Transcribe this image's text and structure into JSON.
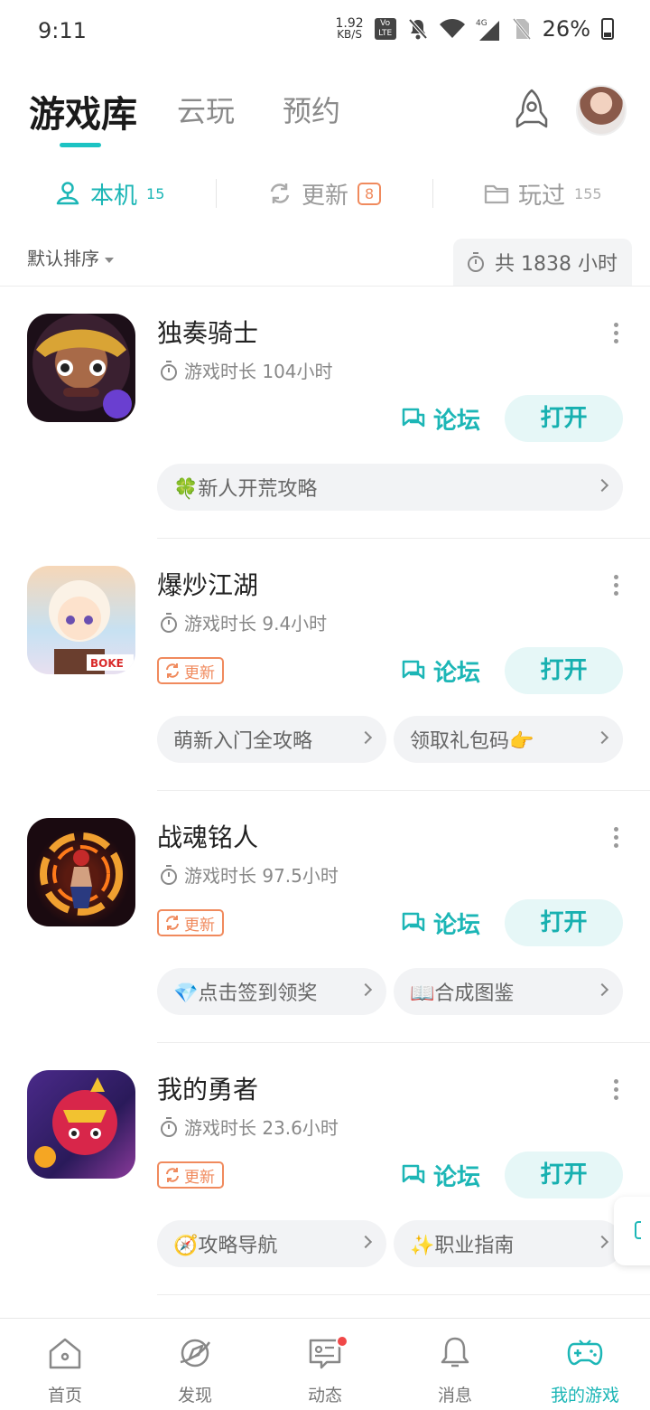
{
  "status_bar": {
    "time": "9:11",
    "net_speed": "1.92",
    "net_unit": "KB/S",
    "volte": "Vo LTE",
    "network": "4G",
    "battery": "26%"
  },
  "header": {
    "tabs": [
      {
        "label": "游戏库",
        "active": true
      },
      {
        "label": "云玩",
        "active": false
      },
      {
        "label": "预约",
        "active": false
      }
    ],
    "rocket_icon": "rocket-icon",
    "avatar_icon": "user-avatar"
  },
  "subtabs": [
    {
      "label": "本机",
      "count": "15",
      "icon": "user-device-icon",
      "active": true
    },
    {
      "label": "更新",
      "badge": "8",
      "icon": "refresh-icon",
      "active": false
    },
    {
      "label": "玩过",
      "count": "155",
      "icon": "folder-icon",
      "active": false
    }
  ],
  "sort": {
    "label": "默认排序",
    "total_hours": "共 1838 小时"
  },
  "games": [
    {
      "name": "独奏骑士",
      "playtime": "游戏时长 104小时",
      "has_update": false,
      "forum_label": "论坛",
      "open_label": "打开",
      "chips": [
        "🍀新人开荒攻略"
      ]
    },
    {
      "name": "爆炒江湖",
      "playtime": "游戏时长 9.4小时",
      "has_update": true,
      "update_label": "更新",
      "forum_label": "论坛",
      "open_label": "打开",
      "chips": [
        "萌新入门全攻略",
        "领取礼包码👉"
      ]
    },
    {
      "name": "战魂铭人",
      "playtime": "游戏时长 97.5小时",
      "has_update": true,
      "update_label": "更新",
      "forum_label": "论坛",
      "open_label": "打开",
      "chips": [
        "💎点击签到领奖",
        "📖合成图鉴"
      ]
    },
    {
      "name": "我的勇者",
      "playtime": "游戏时长 23.6小时",
      "has_update": true,
      "update_label": "更新",
      "forum_label": "论坛",
      "open_label": "打开",
      "chips": [
        "🧭攻略导航",
        "✨职业指南"
      ]
    }
  ],
  "bottom_nav": [
    {
      "label": "首页",
      "icon": "home-icon",
      "active": false
    },
    {
      "label": "发现",
      "icon": "discover-icon",
      "active": false
    },
    {
      "label": "动态",
      "icon": "message-dynamic-icon",
      "active": false,
      "dot": true
    },
    {
      "label": "消息",
      "icon": "bell-icon",
      "active": false
    },
    {
      "label": "我的游戏",
      "icon": "gamepad-icon",
      "active": true
    }
  ],
  "colors": {
    "accent": "#1cb6b6",
    "update_orange": "#f08a5d",
    "notification_red": "#f04848"
  }
}
